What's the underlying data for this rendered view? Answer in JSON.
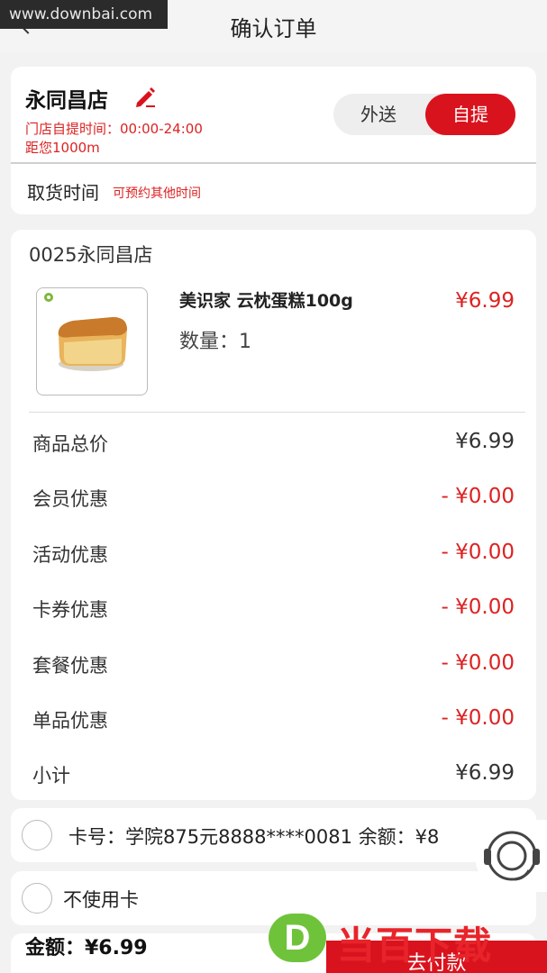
{
  "watermark_top": "www.downbai.com",
  "header": {
    "title": "确认订单"
  },
  "store": {
    "name": "永同昌店",
    "hours": "门店自提时间：00:00-24:00",
    "distance": "距您1000m",
    "delivery_options": [
      "外送",
      "自提"
    ],
    "selected_option": "自提",
    "pickup_label": "取货时间",
    "pickup_hint": "可预约其他时间"
  },
  "order": {
    "shop_code": "0025永同昌店",
    "product": {
      "name": "美识家 云枕蛋糕100g",
      "price": "¥6.99",
      "quantity": "数量：1"
    },
    "summary": [
      {
        "label": "商品总价",
        "value": "¥6.99",
        "color": "#333333"
      },
      {
        "label": "会员优惠",
        "value": "- ¥0.00",
        "color": "#dd2222"
      },
      {
        "label": "活动优惠",
        "value": "- ¥0.00",
        "color": "#dd2222"
      },
      {
        "label": "卡券优惠",
        "value": "- ¥0.00",
        "color": "#dd2222"
      },
      {
        "label": "套餐优惠",
        "value": "- ¥0.00",
        "color": "#dd2222"
      },
      {
        "label": "单品优惠",
        "value": "- ¥0.00",
        "color": "#dd2222"
      },
      {
        "label": "小计",
        "value": "¥6.99",
        "color": "#333333"
      }
    ]
  },
  "payment": {
    "card_option": "卡号：学院875元8888****0081 余额：¥8",
    "no_card_option": "不使用卡",
    "amount": "金额：¥6.99",
    "pay_button": "去付款"
  },
  "watermark_bottom": {
    "logo_letter": "D",
    "text": "当百下载"
  },
  "colors": {
    "accent": "#d9131e",
    "discount": "#dd2222"
  },
  "icons": {
    "back": "chevron-left-icon",
    "edit": "pencil-icon",
    "support": "headset-icon"
  }
}
